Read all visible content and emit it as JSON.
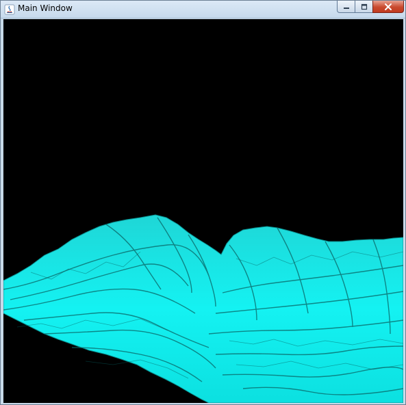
{
  "window": {
    "title": "Main Window",
    "controls": {
      "minimize": "minimize-icon",
      "maximize": "maximize-icon",
      "close": "close-icon"
    }
  },
  "viewport": {
    "background": "#000000",
    "terrain_color": "#00e5e5",
    "terrain_shadow": "#0a6e6e"
  }
}
